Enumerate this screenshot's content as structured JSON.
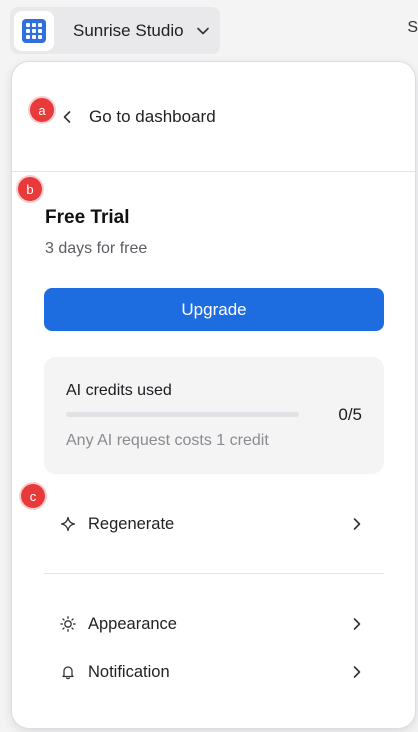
{
  "workspace": {
    "name": "Sunrise Studio",
    "logo_icon": "grid-app-icon",
    "dropdown_icon": "chevron-down-icon"
  },
  "background": {
    "edge_glyph": "S"
  },
  "panel": {
    "back_label": "Go to dashboard",
    "plan": {
      "title": "Free Trial",
      "subtitle": "3 days for free",
      "upgrade_label": "Upgrade"
    },
    "credits": {
      "title": "AI credits used",
      "count": "0/5",
      "used_fraction": 0,
      "note": "Any AI request costs 1 credit"
    },
    "menu": [
      {
        "label": "Regenerate",
        "icon": "sparkle-icon"
      },
      {
        "label": "Appearance",
        "icon": "sun-icon"
      },
      {
        "label": "Notification",
        "icon": "bell-icon"
      }
    ]
  },
  "annotations": [
    "a",
    "b",
    "c"
  ],
  "colors": {
    "accent": "#1d6de0",
    "badge": "#e8393b",
    "logo": "#2f6fe0"
  }
}
